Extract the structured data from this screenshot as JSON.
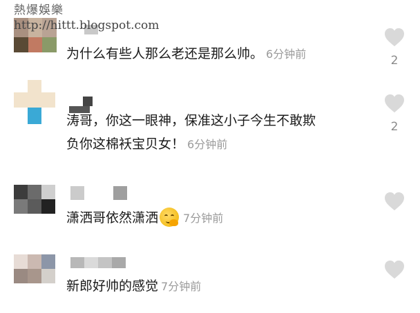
{
  "watermark": {
    "title": "熱爆娛樂",
    "url": "http://hittt.blogspot.com"
  },
  "colors": {
    "heart": "#d9d9d9",
    "time": "#9a9a9a"
  },
  "comments": [
    {
      "text": "为什么有些人那么老还是那么帅。",
      "time": "6分钟前",
      "likes": "2"
    },
    {
      "text_line1": "涛哥，你这一眼神，保准这小子今生不敢欺",
      "text_line2": "负你这棉袄宝贝女！",
      "time": "6分钟前",
      "likes": "2"
    },
    {
      "text": "潇洒哥依然潇洒",
      "emoji": "smirk-emoji",
      "time": "7分钟前"
    },
    {
      "text": "新郎好帅的感觉",
      "time": "7分钟前"
    }
  ]
}
